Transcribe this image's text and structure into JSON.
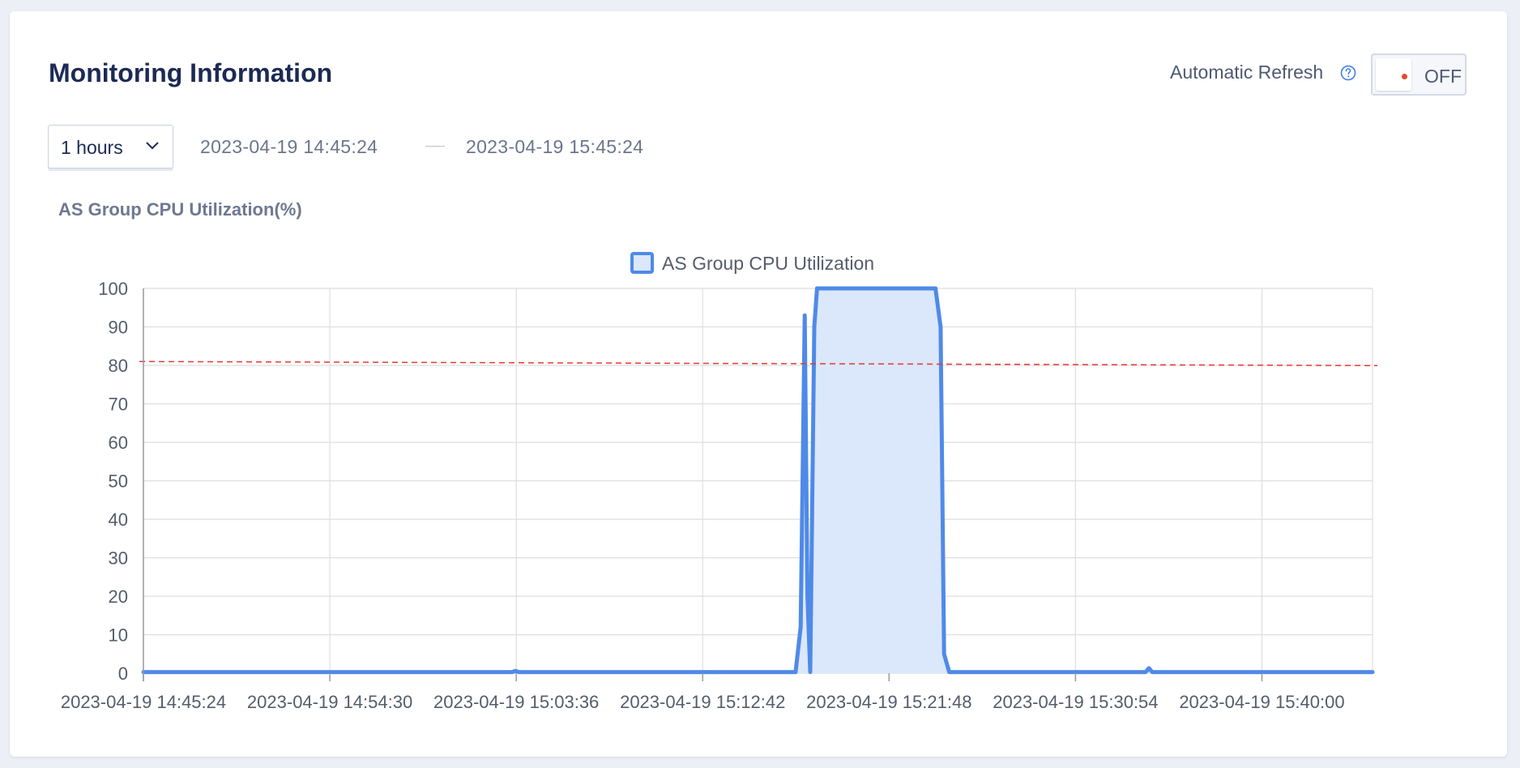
{
  "header": {
    "title": "Monitoring Information",
    "auto_refresh_label": "Automatic Refresh",
    "help_icon": "question-circle-icon",
    "toggle_state": "OFF"
  },
  "filter": {
    "range_value": "1 hours",
    "start_time": "2023-04-19 14:45:24",
    "end_time": "2023-04-19 15:45:24"
  },
  "colors": {
    "accent": "#4f8ae8",
    "area_fill": "#dbe7fb",
    "threshold": "#e53935",
    "title": "#1c2a55"
  },
  "chart_data": {
    "type": "area",
    "title": "AS Group CPU Utilization(%)",
    "xlabel": "",
    "ylabel": "",
    "ylim": [
      0,
      100
    ],
    "yticks": [
      0,
      10,
      20,
      30,
      40,
      50,
      60,
      70,
      80,
      90,
      100
    ],
    "xlim": [
      0,
      3600
    ],
    "xticks": [
      0,
      546,
      1092,
      1638,
      2184,
      2730,
      3276
    ],
    "xtick_labels": [
      "2023-04-19 14:45:24",
      "2023-04-19 14:54:30",
      "2023-04-19 15:03:36",
      "2023-04-19 15:12:42",
      "2023-04-19 15:21:48",
      "2023-04-19 15:30:54",
      "2023-04-19 15:40:00"
    ],
    "grid": true,
    "legend_position": "top-center",
    "threshold": 81,
    "series": [
      {
        "name": "AS Group CPU Utilization",
        "x": [
          0,
          360,
          720,
          1080,
          1090,
          1100,
          1440,
          1800,
          1910,
          1925,
          1937,
          1945,
          1953,
          1965,
          1973,
          1990,
          2000,
          2200,
          2320,
          2335,
          2345,
          2360,
          2700,
          2935,
          2945,
          2955,
          2965,
          3300,
          3600
        ],
        "values": [
          0.3,
          0.3,
          0.3,
          0.3,
          0.6,
          0.3,
          0.3,
          0.3,
          0.3,
          12,
          93,
          20,
          0.3,
          90,
          100,
          100,
          100,
          100,
          100,
          90,
          5,
          0.3,
          0.3,
          0.3,
          1.3,
          0.3,
          0.3,
          0.3,
          0.3
        ]
      }
    ]
  }
}
